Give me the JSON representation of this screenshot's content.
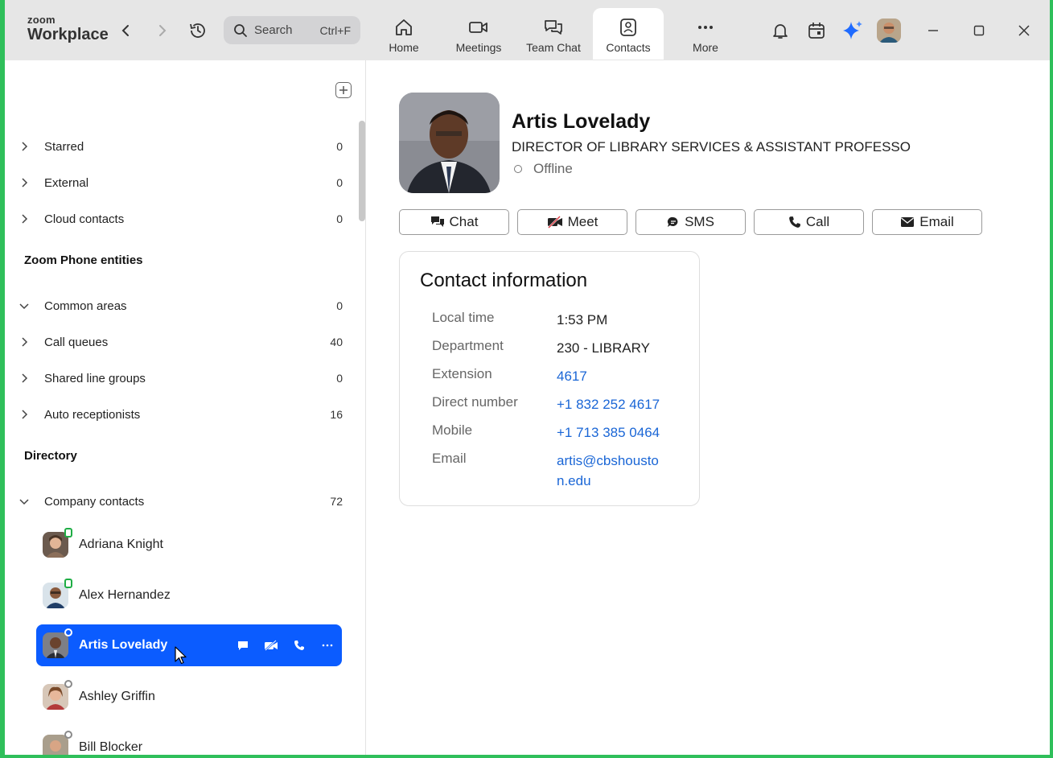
{
  "app": {
    "logo_small": "zoom",
    "logo_big": "Workplace"
  },
  "search": {
    "label": "Search",
    "shortcut": "Ctrl+F"
  },
  "tabs": [
    {
      "label": "Home",
      "icon": "home-icon"
    },
    {
      "label": "Meetings",
      "icon": "video-camera-icon"
    },
    {
      "label": "Team Chat",
      "icon": "chat-bubbles-icon"
    },
    {
      "label": "Contacts",
      "icon": "contact-card-icon",
      "active": true
    },
    {
      "label": "More",
      "icon": "more-dots-icon"
    }
  ],
  "sidebar": {
    "groups": [
      {
        "label": "Starred",
        "count": "0",
        "expanded": false
      },
      {
        "label": "External",
        "count": "0",
        "expanded": false
      },
      {
        "label": "Cloud contacts",
        "count": "0",
        "expanded": false
      }
    ],
    "phone_section_title": "Zoom Phone entities",
    "phone_groups": [
      {
        "label": "Common areas",
        "count": "0",
        "expanded": true
      },
      {
        "label": "Call queues",
        "count": "40",
        "expanded": false
      },
      {
        "label": "Shared line groups",
        "count": "0",
        "expanded": false
      },
      {
        "label": "Auto receptionists",
        "count": "16",
        "expanded": false
      }
    ],
    "directory_title": "Directory",
    "company_group": {
      "label": "Company contacts",
      "count": "72",
      "expanded": true
    },
    "contacts": [
      {
        "name": "Adriana Knight",
        "status": "mobile-online"
      },
      {
        "name": "Alex Hernandez",
        "status": "mobile-online"
      },
      {
        "name": "Artis Lovelady",
        "status": "offline",
        "selected": true
      },
      {
        "name": "Ashley Griffin",
        "status": "offline"
      },
      {
        "name": "Bill Blocker",
        "status": "away"
      }
    ]
  },
  "profile": {
    "name": "Artis Lovelady",
    "title": "DIRECTOR OF LIBRARY SERVICES & ASSISTANT PROFESSO",
    "status": "Offline",
    "actions": [
      "Chat",
      "Meet",
      "SMS",
      "Call",
      "Email"
    ]
  },
  "contact_info": {
    "title": "Contact information",
    "rows": [
      {
        "key": "Local time",
        "value": "1:53 PM",
        "link": false
      },
      {
        "key": "Department",
        "value": "230 - LIBRARY",
        "link": false
      },
      {
        "key": "Extension",
        "value": "4617",
        "link": true
      },
      {
        "key": "Direct number",
        "value": "+1 832 252 4617",
        "link": true
      },
      {
        "key": "Mobile",
        "value": "+1 713 385 0464",
        "link": true
      },
      {
        "key": "Email",
        "value": "artis@cbshouston.edu",
        "link": true
      }
    ]
  },
  "colors": {
    "accent": "#0b5cff",
    "link": "#1a66d6",
    "online": "#1fad45",
    "window_border": "#2fbf5a",
    "topbar": "#e6e6e6"
  }
}
